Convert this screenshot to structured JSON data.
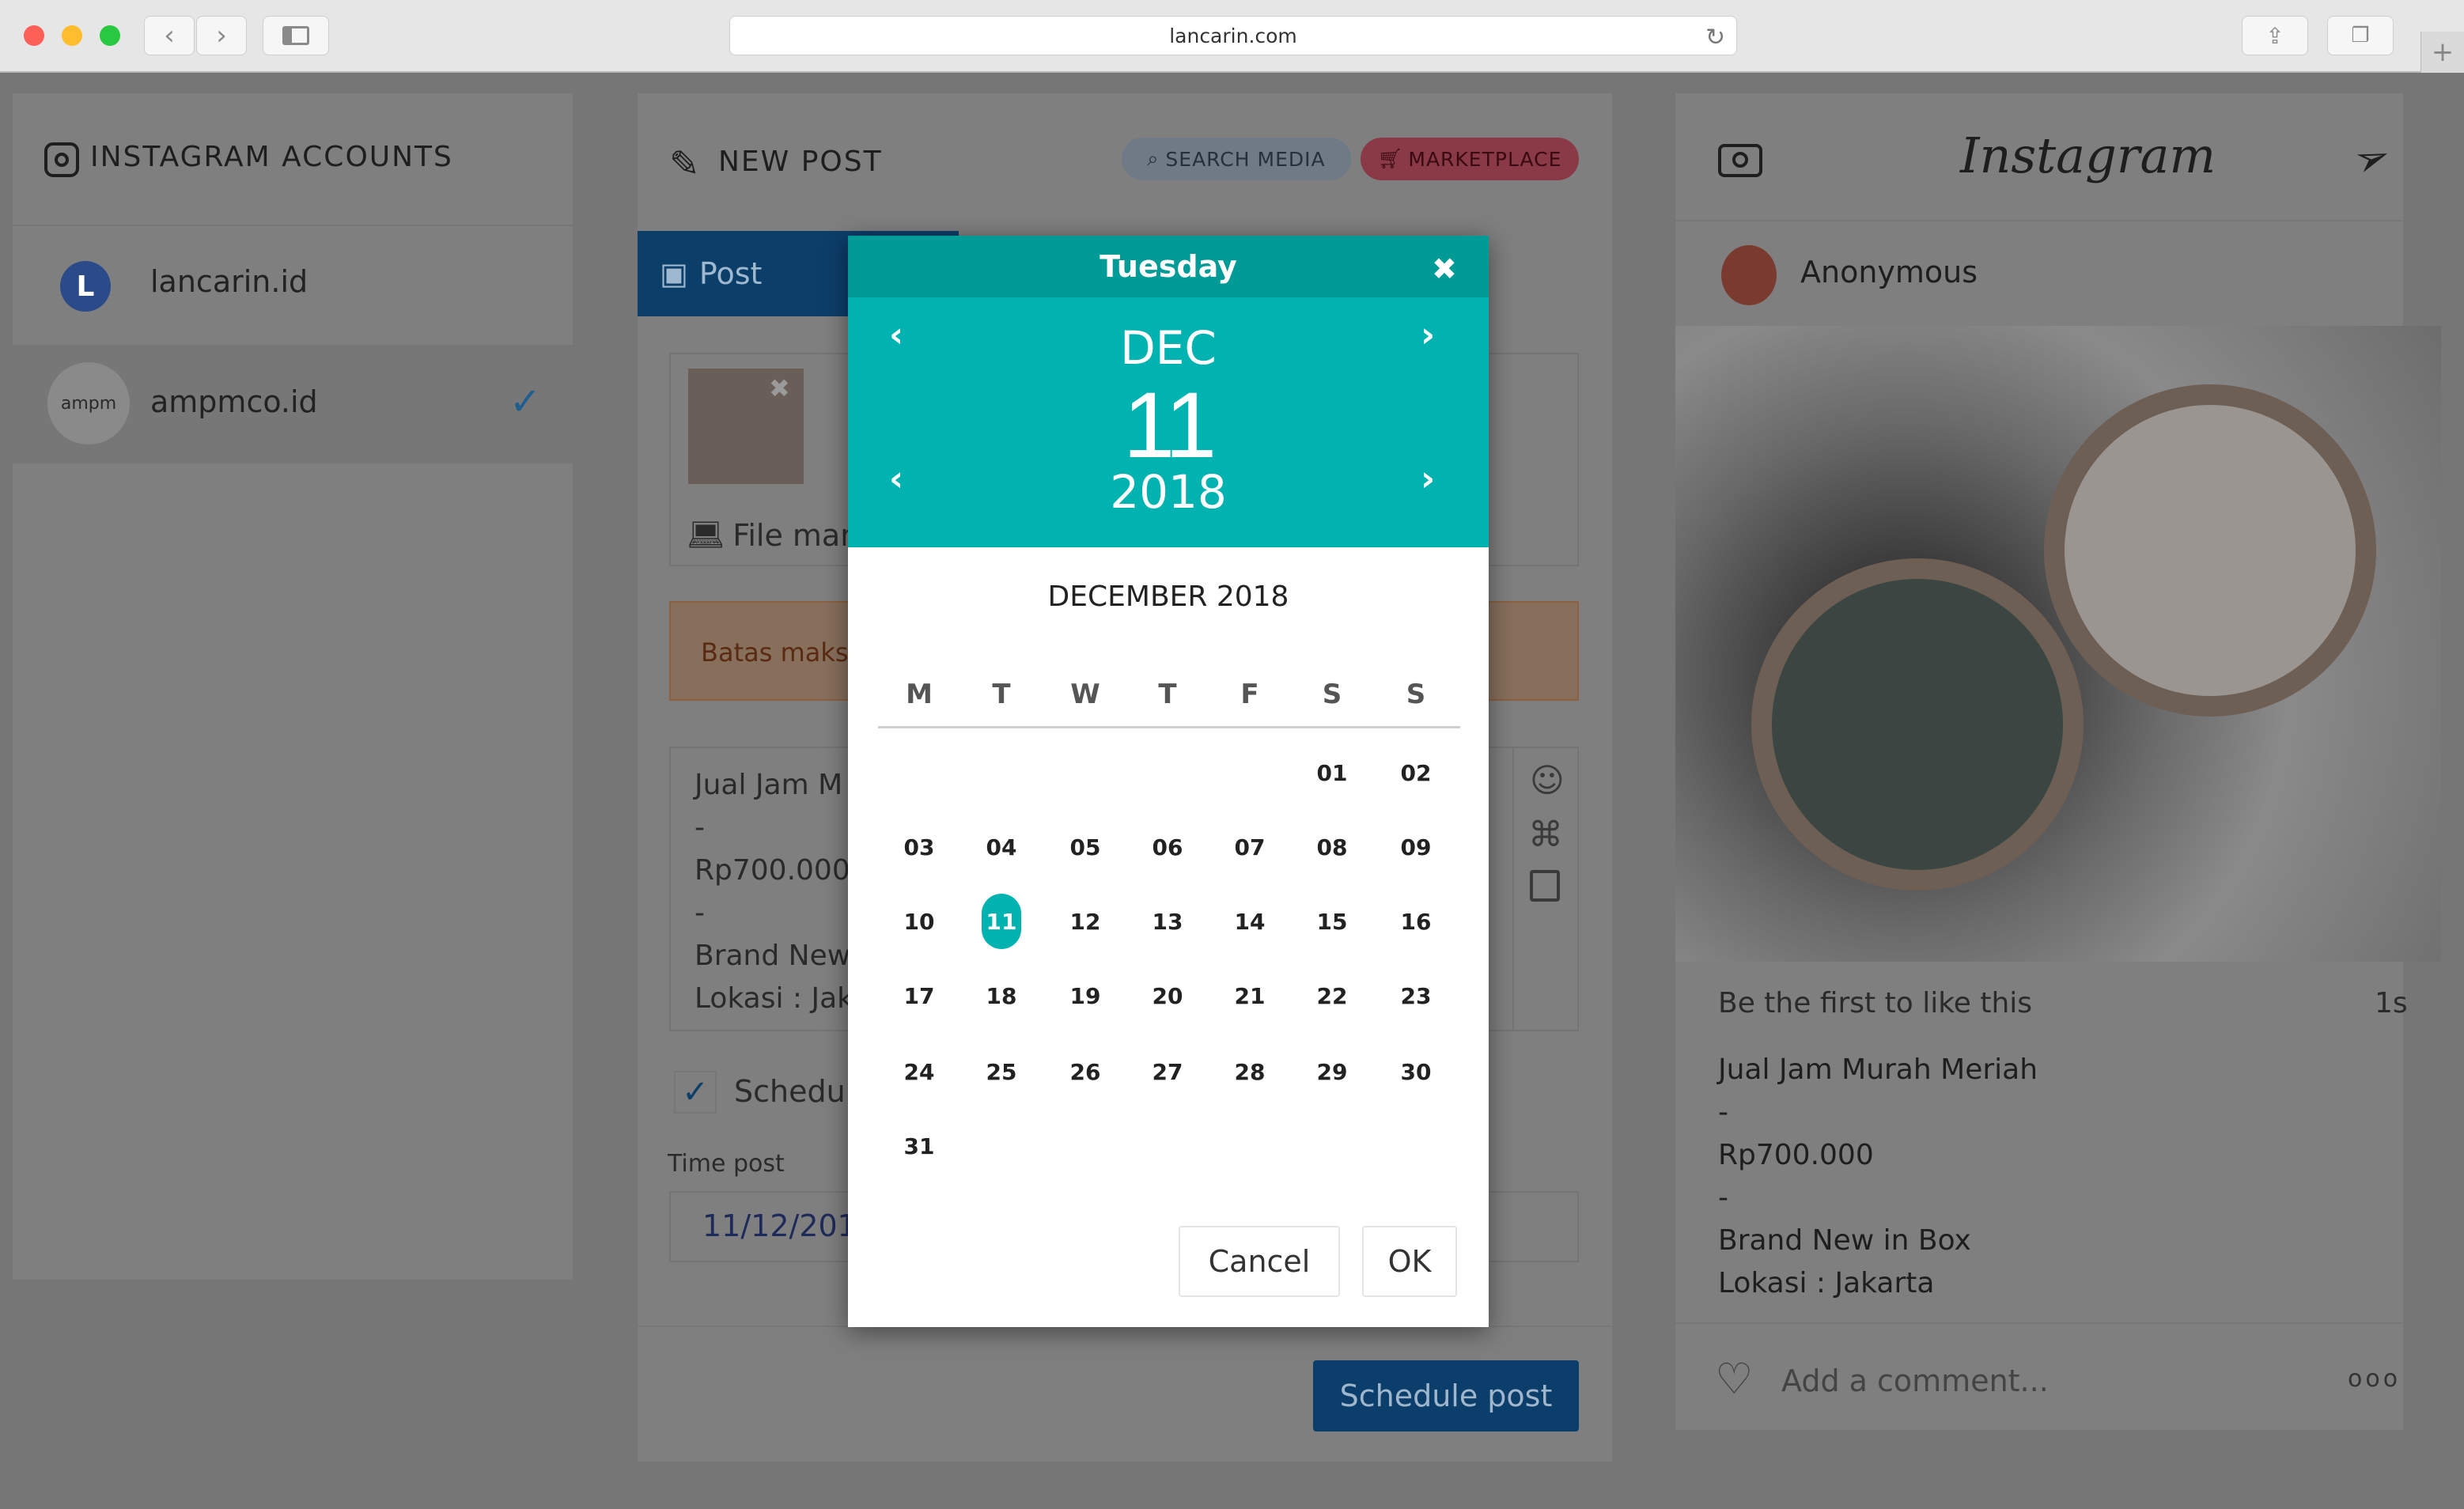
{
  "browser": {
    "url": "lancarin.com"
  },
  "accounts": {
    "title": "INSTAGRAM ACCOUNTS",
    "items": [
      {
        "name": "lancarin.id",
        "avatar_text": "L"
      },
      {
        "name": "ampmco.id",
        "avatar_text": "ampm"
      }
    ]
  },
  "new_post": {
    "title": "NEW POST",
    "search_media": "SEARCH MEDIA",
    "marketplace": "MARKETPLACE",
    "tab_post": "Post",
    "file_manager": "File man",
    "warning": "Batas maks",
    "caption_lines": [
      "Jual Jam M",
      "-",
      "Rp700.000",
      "-",
      "Brand New",
      "Lokasi : Jak"
    ],
    "schedule_label": "Schedu",
    "time_post_label": "Time post",
    "time_post_value": "11/12/2018 2",
    "schedule_button": "Schedule post"
  },
  "preview": {
    "brand": "Instagram",
    "user": "Anonymous",
    "likes": "Be the first to like this",
    "time": "1s",
    "caption_lines": [
      "Jual Jam Murah Meriah",
      "-",
      "Rp700.000",
      "-",
      "Brand New in Box",
      "Lokasi : Jakarta"
    ],
    "comment_placeholder": "Add a comment...",
    "more": "ooo"
  },
  "datepicker": {
    "weekday": "Tuesday",
    "month": "DEC",
    "day": "11",
    "year": "2018",
    "calendar_title": "DECEMBER 2018",
    "weekdays": [
      "M",
      "T",
      "W",
      "T",
      "F",
      "S",
      "S"
    ],
    "weeks": [
      [
        "",
        "",
        "",
        "",
        "",
        "01",
        "02"
      ],
      [
        "03",
        "04",
        "05",
        "06",
        "07",
        "08",
        "09"
      ],
      [
        "10",
        "11",
        "12",
        "13",
        "14",
        "15",
        "16"
      ],
      [
        "17",
        "18",
        "19",
        "20",
        "21",
        "22",
        "23"
      ],
      [
        "24",
        "25",
        "26",
        "27",
        "28",
        "29",
        "30"
      ],
      [
        "31",
        "",
        "",
        "",
        "",
        "",
        ""
      ]
    ],
    "selected": "11",
    "cancel": "Cancel",
    "ok": "OK",
    "accent": "#00b2b0"
  }
}
